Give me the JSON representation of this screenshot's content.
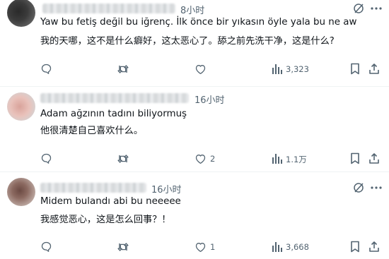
{
  "posts": [
    {
      "time": "8小时",
      "text": "Yaw bu fetiş değil bu iğrenç. İlk önce bir yıkasın öyle yala bu ne aw",
      "translation": "我的天哪，这不是什么癖好，这太恶心了。舔之前先洗干净，这是什么?",
      "likes": "",
      "views": "3,323"
    },
    {
      "time": "16小时",
      "text": "Adam ağzının tadını biliyormuş",
      "translation": "他很清楚自己喜欢什么。",
      "likes": "2",
      "views": "1.1万"
    },
    {
      "time": "16小时",
      "text": "Midem bulandı abi bu neeeee",
      "translation": "我感觉恶心，这是怎么回事？！",
      "likes": "1",
      "views": "3,668"
    }
  ],
  "icons": {
    "reply": "reply-icon",
    "repost": "repost-icon",
    "like": "like-icon",
    "views": "views-icon",
    "bookmark": "bookmark-icon",
    "grok": "grok-icon",
    "more": "more-icon"
  },
  "colors": {
    "text": "#0f1419",
    "muted": "#536471",
    "separator": "#eff3f4"
  }
}
